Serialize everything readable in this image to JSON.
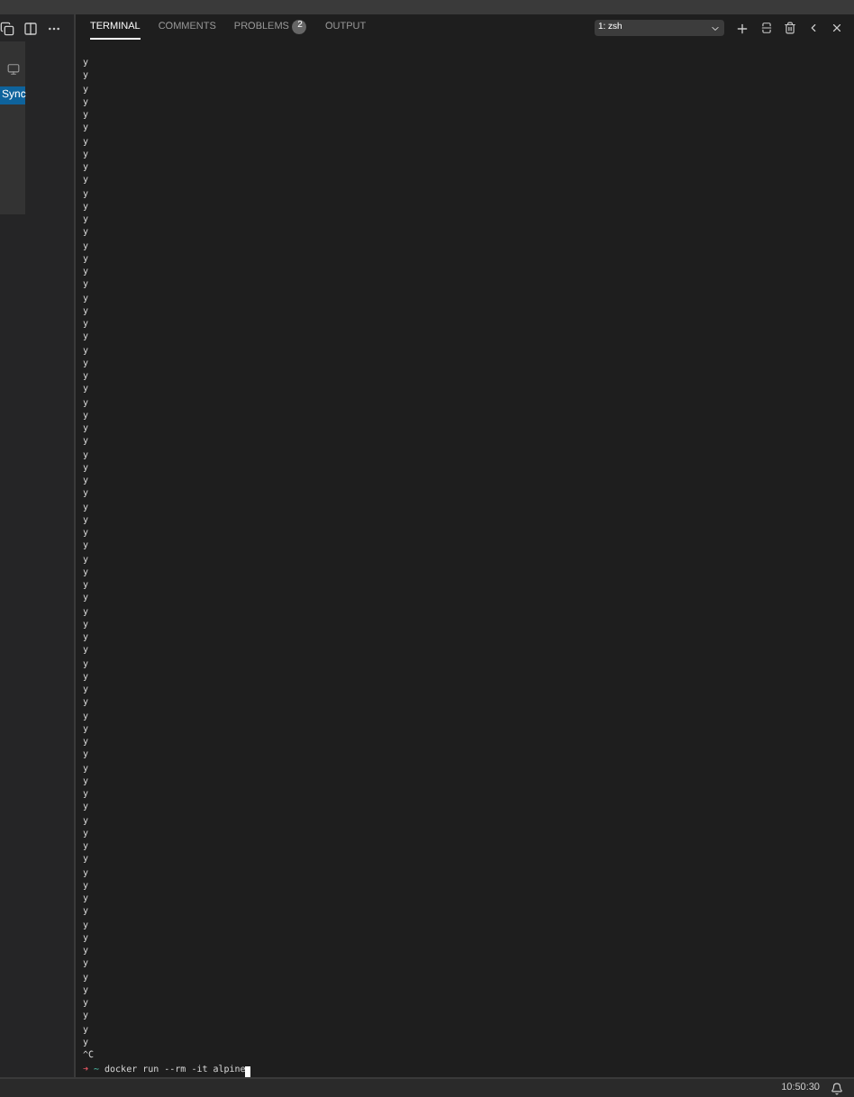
{
  "sidebar": {
    "button": "Sync"
  },
  "panel": {
    "tabs": [
      {
        "label": "TERMINAL",
        "selected": true
      },
      {
        "label": "COMMENTS",
        "selected": false
      },
      {
        "label": "PROBLEMS",
        "selected": false,
        "badge": "2"
      },
      {
        "label": "OUTPUT",
        "selected": false
      }
    ],
    "terminal_select": "1: zsh"
  },
  "terminal": {
    "lines": [
      "y",
      "y",
      "y",
      "y",
      "y",
      "y",
      "y",
      "y",
      "y",
      "y",
      "y",
      "y",
      "y",
      "y",
      "y",
      "y",
      "y",
      "y",
      "y",
      "y",
      "y",
      "y",
      "y",
      "y",
      "y",
      "y",
      "y",
      "y",
      "y",
      "y",
      "y",
      "y",
      "y",
      "y",
      "y",
      "y",
      "y",
      "y",
      "y",
      "y",
      "y",
      "y",
      "y",
      "y",
      "y",
      "y",
      "y",
      "y",
      "y",
      "y",
      "y",
      "y",
      "y",
      "y",
      "y",
      "y",
      "y",
      "y",
      "y",
      "y",
      "y",
      "y",
      "y",
      "y",
      "y",
      "y",
      "y",
      "y",
      "y",
      "y",
      "y",
      "y",
      "y",
      "y",
      "y",
      "y",
      "^C"
    ],
    "prompt": {
      "arrow": "➜",
      "dir": "~",
      "command": "docker run --rm -it alpine"
    }
  },
  "status_bar": {
    "time": "10:50:30"
  }
}
